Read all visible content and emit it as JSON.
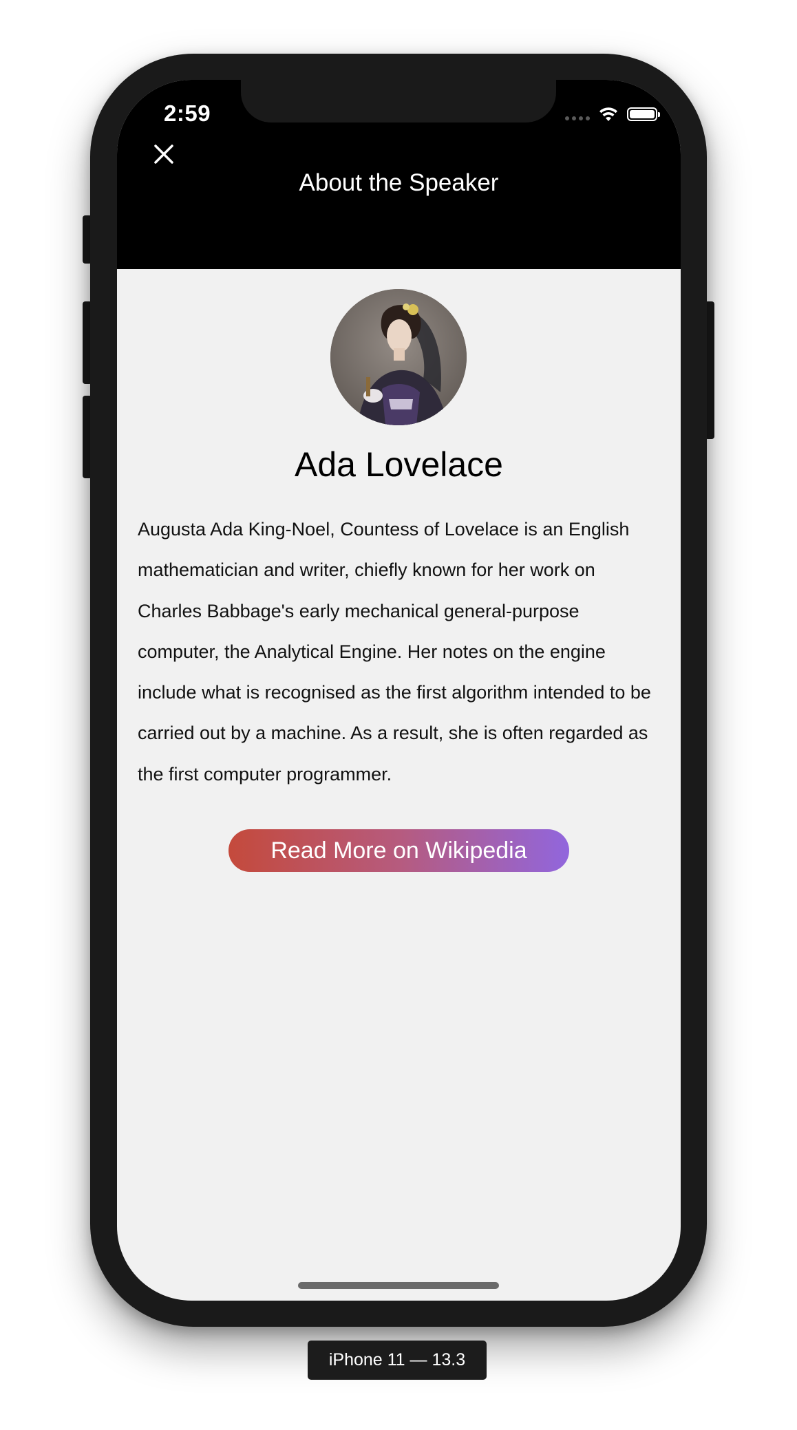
{
  "status_bar": {
    "time": "2:59",
    "icons": [
      "signal-icon",
      "wifi-icon",
      "battery-icon"
    ]
  },
  "nav": {
    "close_icon": "close-icon",
    "title": "About the Speaker"
  },
  "speaker": {
    "avatar": "speaker-portrait",
    "name": "Ada Lovelace",
    "bio": "Augusta Ada King-Noel, Countess of Lovelace is an English mathematician and writer, chiefly known for her work on Charles Babbage's early mechanical general-purpose computer, the Analytical Engine. Her notes on the engine include what is recognised as the first algorithm intended to be carried out by a machine. As a result, she is often regarded as the first computer programmer."
  },
  "actions": {
    "read_more_label": "Read More on Wikipedia"
  },
  "simulator": {
    "device_label": "iPhone 11 — 13.3"
  },
  "colors": {
    "header_bg": "#000000",
    "content_bg": "#f1f1f1",
    "button_gradient_start": "#c44a3c",
    "button_gradient_end": "#9166dd"
  }
}
